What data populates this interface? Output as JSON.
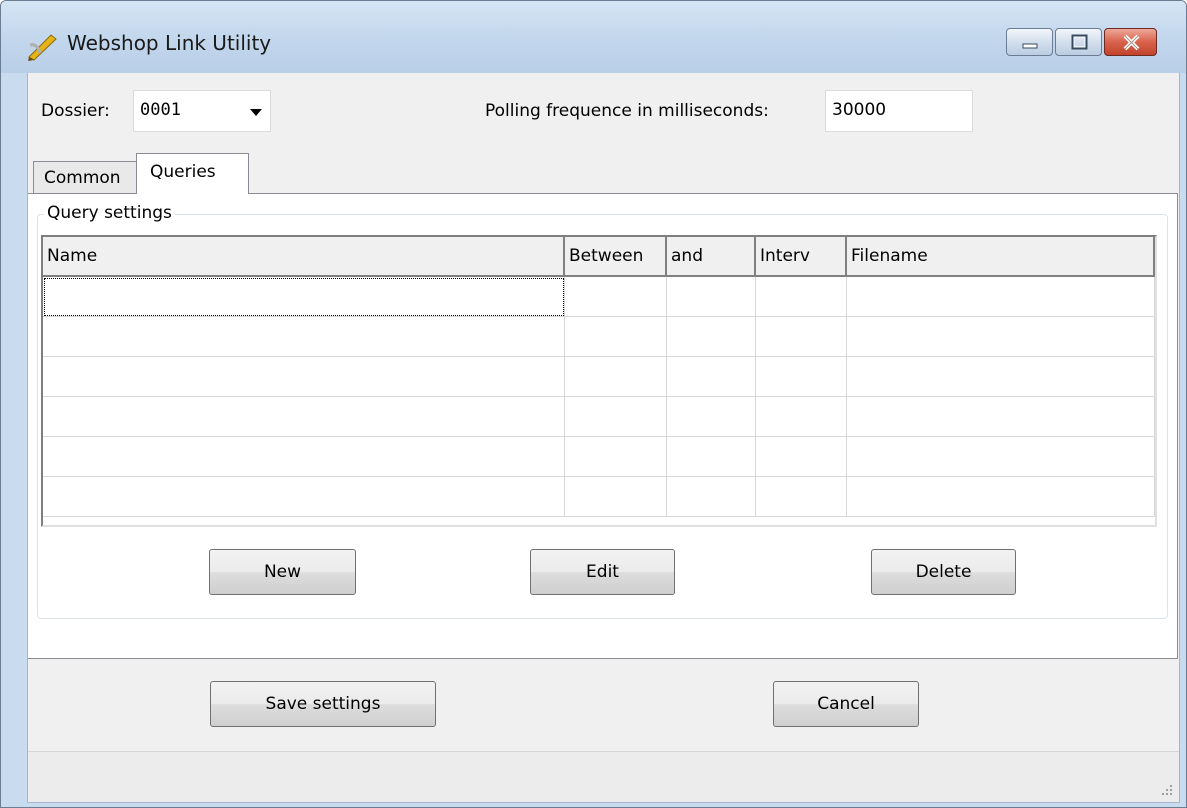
{
  "window": {
    "title": "Webshop Link Utility",
    "icon": "pencil-icon",
    "controls": {
      "minimize": "minimize-icon",
      "maximize": "maximize-icon",
      "close": "close-icon"
    }
  },
  "settings": {
    "dossier_label": "Dossier:",
    "dossier_value": "0001",
    "polling_label": "Polling frequence in milliseconds:",
    "polling_value": "30000"
  },
  "tabs": [
    {
      "label": "Common",
      "active": false
    },
    {
      "label": "Queries",
      "active": true
    }
  ],
  "query_settings": {
    "group_title": "Query settings",
    "columns": [
      "Name",
      "Between",
      "and",
      "Interv",
      "Filename"
    ],
    "rows": [
      [
        "",
        "",
        "",
        "",
        ""
      ],
      [
        "",
        "",
        "",
        "",
        ""
      ],
      [
        "",
        "",
        "",
        "",
        ""
      ],
      [
        "",
        "",
        "",
        "",
        ""
      ],
      [
        "",
        "",
        "",
        "",
        ""
      ],
      [
        "",
        "",
        "",
        "",
        ""
      ]
    ],
    "buttons": {
      "new": "New",
      "edit": "Edit",
      "delete": "Delete"
    }
  },
  "footer": {
    "save": "Save settings",
    "cancel": "Cancel"
  },
  "colors": {
    "title_bar": "#c9dbee",
    "close_button": "#c2442d",
    "client_background": "#f0f0f0"
  }
}
